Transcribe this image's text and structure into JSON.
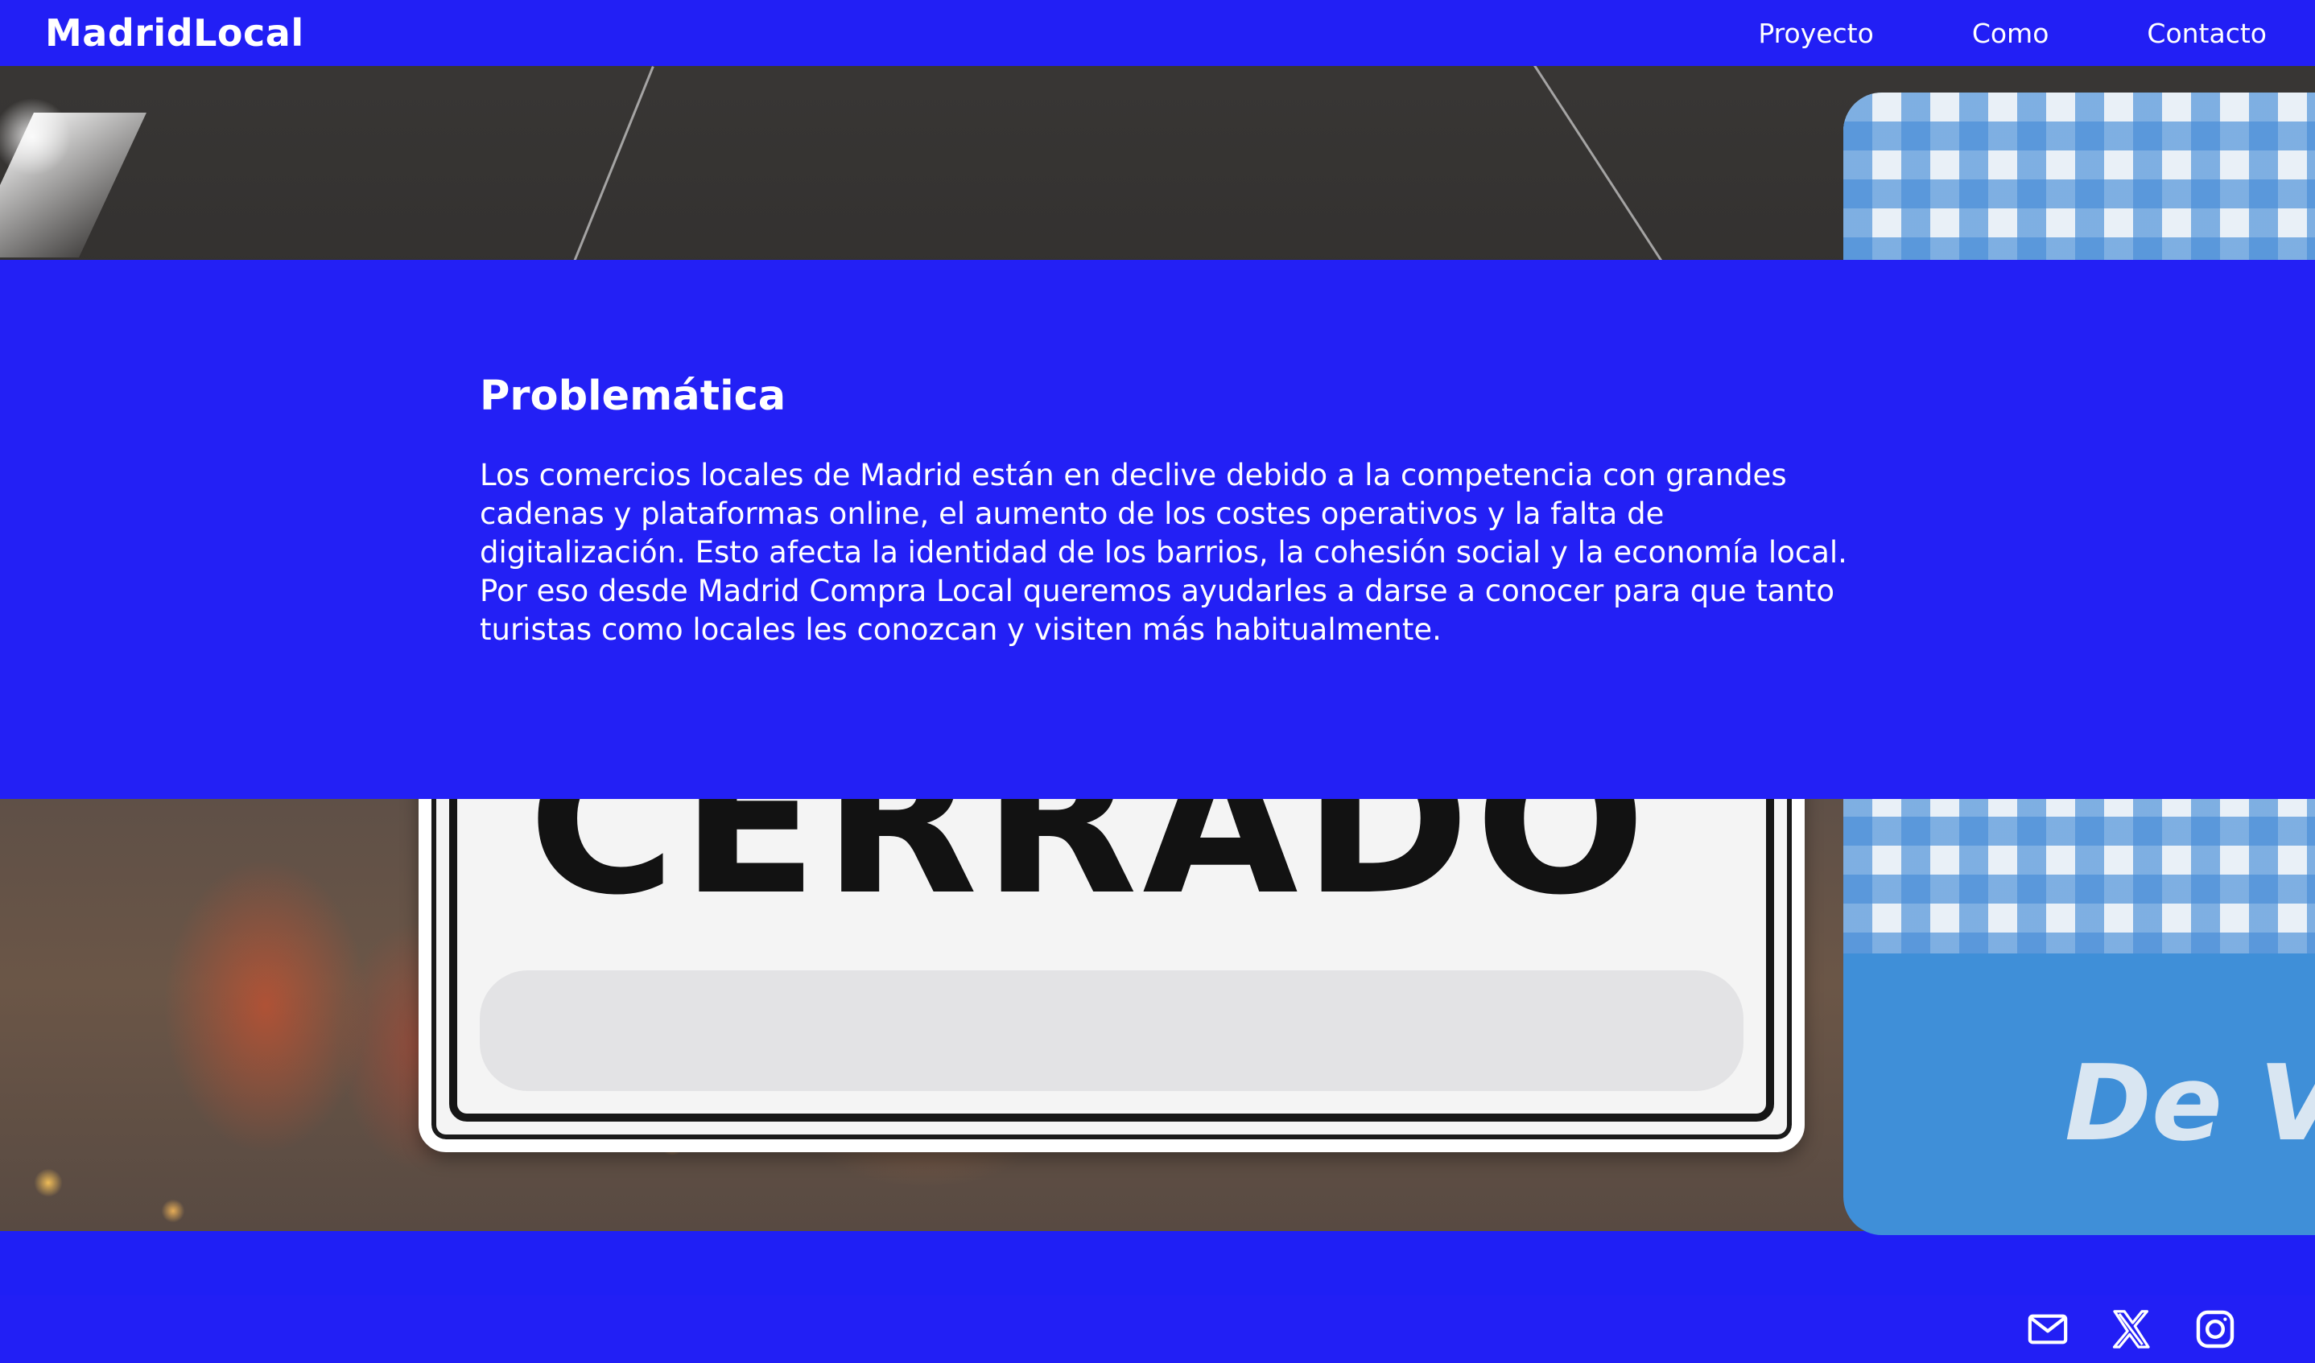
{
  "header": {
    "brand": "MadridLocal",
    "nav": [
      {
        "label": "Proyecto"
      },
      {
        "label": "Como"
      },
      {
        "label": "Contacto"
      }
    ]
  },
  "hero_image": {
    "sign_text": "CERRADO",
    "badge_text": "De V"
  },
  "section": {
    "title": "Problemática",
    "body": "Los comercios locales de Madrid están en declive debido a la competencia con grandes cadenas y plataformas online, el aumento de los costes operativos y la falta de digitalización. Esto afecta la identidad de los barrios, la cohesión social y la economía local. Por eso desde Madrid Compra Local queremos ayudarles a darse a conocer para que tanto turistas como locales les conozcan y visiten más habitualmente."
  },
  "footer": {
    "social": [
      {
        "icon": "mail-icon"
      },
      {
        "icon": "x-icon"
      },
      {
        "icon": "instagram-icon"
      }
    ]
  },
  "colors": {
    "brand_blue": "#221ff5",
    "text": "#ffffff"
  }
}
